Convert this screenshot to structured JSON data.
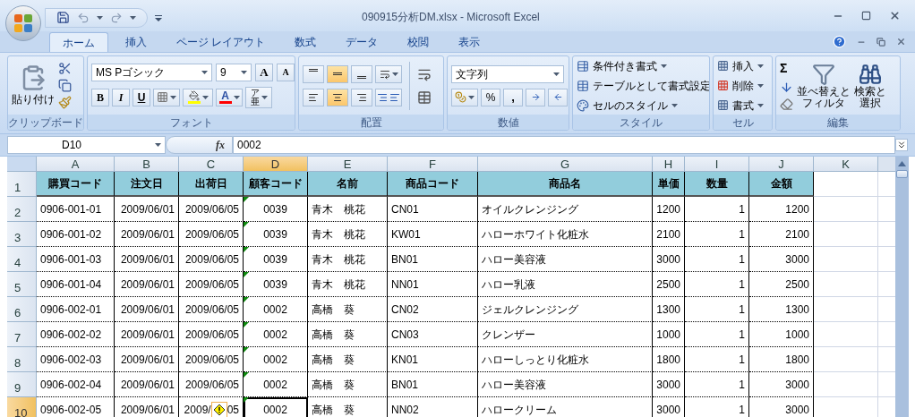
{
  "window": {
    "title": "090915分析DM.xlsx - Microsoft Excel"
  },
  "tabs": [
    {
      "label": "ホーム",
      "selected": true
    },
    {
      "label": "挿入",
      "selected": false
    },
    {
      "label": "ページ レイアウト",
      "selected": false
    },
    {
      "label": "数式",
      "selected": false
    },
    {
      "label": "データ",
      "selected": false
    },
    {
      "label": "校閲",
      "selected": false
    },
    {
      "label": "表示",
      "selected": false
    }
  ],
  "ribbon": {
    "clipboard": {
      "label": "クリップボード",
      "paste": "貼り付け"
    },
    "font": {
      "label": "フォント",
      "font_name": "MS Pゴシック",
      "font_size": "9",
      "grow": "A",
      "shrink": "A",
      "bold": "B",
      "italic": "I",
      "underline": "U",
      "font_color": "A",
      "phonetic_top": "ア",
      "phonetic_bottom": "亜"
    },
    "alignment": {
      "label": "配置",
      "vertical": [
        {
          "selected": false
        },
        {
          "selected": true
        },
        {
          "selected": false
        }
      ],
      "horizontal": [
        {
          "selected": false
        },
        {
          "selected": true
        },
        {
          "selected": false
        }
      ]
    },
    "number": {
      "label": "数値",
      "format": "文字列",
      "percent": "%",
      "comma": ","
    },
    "styles": {
      "label": "スタイル",
      "items": [
        "条件付き書式",
        "テーブルとして書式設定",
        "セルのスタイル"
      ]
    },
    "cells": {
      "label": "セル",
      "items": [
        "挿入",
        "削除",
        "書式"
      ]
    },
    "editing": {
      "label": "編集",
      "sum": "Σ",
      "sort": [
        "並べ替えと",
        "フィルタ"
      ],
      "find": [
        "検索と",
        "選択"
      ]
    }
  },
  "formula_bar": {
    "name_box": "D10",
    "fx": "fx",
    "value": "0002"
  },
  "sheet": {
    "columns": [
      {
        "label": "A",
        "selected": false
      },
      {
        "label": "B",
        "selected": false
      },
      {
        "label": "C",
        "selected": false
      },
      {
        "label": "D",
        "selected": true
      },
      {
        "label": "E",
        "selected": false
      },
      {
        "label": "F",
        "selected": false
      },
      {
        "label": "G",
        "selected": false
      },
      {
        "label": "H",
        "selected": false
      },
      {
        "label": "I",
        "selected": false
      },
      {
        "label": "J",
        "selected": false
      },
      {
        "label": "K",
        "selected": false
      }
    ],
    "header_row": {
      "label": "1",
      "cells": [
        "購買コード",
        "注文日",
        "出荷日",
        "顧客コード",
        "名前",
        "商品コード",
        "商品名",
        "単価",
        "数量",
        "金額"
      ]
    },
    "rows": [
      {
        "label": "2",
        "selected": false,
        "flagged": true,
        "warning": false,
        "cells": [
          "0906-001-01",
          "2009/06/01",
          "2009/06/05",
          "0039",
          "青木　桃花",
          "CN01",
          "オイルクレンジング",
          "1200",
          "1",
          "1200"
        ]
      },
      {
        "label": "3",
        "selected": false,
        "flagged": true,
        "warning": false,
        "cells": [
          "0906-001-02",
          "2009/06/01",
          "2009/06/05",
          "0039",
          "青木　桃花",
          "KW01",
          "ハローホワイト化粧水",
          "2100",
          "1",
          "2100"
        ]
      },
      {
        "label": "4",
        "selected": false,
        "flagged": true,
        "warning": false,
        "cells": [
          "0906-001-03",
          "2009/06/01",
          "2009/06/05",
          "0039",
          "青木　桃花",
          "BN01",
          "ハロー美容液",
          "3000",
          "1",
          "3000"
        ]
      },
      {
        "label": "5",
        "selected": false,
        "flagged": true,
        "warning": false,
        "cells": [
          "0906-001-04",
          "2009/06/01",
          "2009/06/05",
          "0039",
          "青木　桃花",
          "NN01",
          "ハロー乳液",
          "2500",
          "1",
          "2500"
        ]
      },
      {
        "label": "6",
        "selected": false,
        "flagged": true,
        "warning": false,
        "cells": [
          "0906-002-01",
          "2009/06/01",
          "2009/06/05",
          "0002",
          "高橋　葵",
          "CN02",
          "ジェルクレンジング",
          "1300",
          "1",
          "1300"
        ]
      },
      {
        "label": "7",
        "selected": false,
        "flagged": true,
        "warning": false,
        "cells": [
          "0906-002-02",
          "2009/06/01",
          "2009/06/05",
          "0002",
          "高橋　葵",
          "CN03",
          "クレンザー",
          "1000",
          "1",
          "1000"
        ]
      },
      {
        "label": "8",
        "selected": false,
        "flagged": true,
        "warning": false,
        "cells": [
          "0906-002-03",
          "2009/06/01",
          "2009/06/05",
          "0002",
          "高橋　葵",
          "KN01",
          "ハローしっとり化粧水",
          "1800",
          "1",
          "1800"
        ]
      },
      {
        "label": "9",
        "selected": false,
        "flagged": true,
        "warning": false,
        "cells": [
          "0906-002-04",
          "2009/06/01",
          "2009/06/05",
          "0002",
          "高橋　葵",
          "BN01",
          "ハロー美容液",
          "3000",
          "1",
          "3000"
        ]
      },
      {
        "label": "10",
        "selected": true,
        "flagged": true,
        "warning": true,
        "cells": [
          "0906-002-05",
          "2009/06/01",
          [
            "2009/",
            "05"
          ],
          "0002",
          "高橋　葵",
          "NN02",
          "ハロークリーム",
          "3000",
          "1",
          "3000"
        ]
      }
    ]
  }
}
